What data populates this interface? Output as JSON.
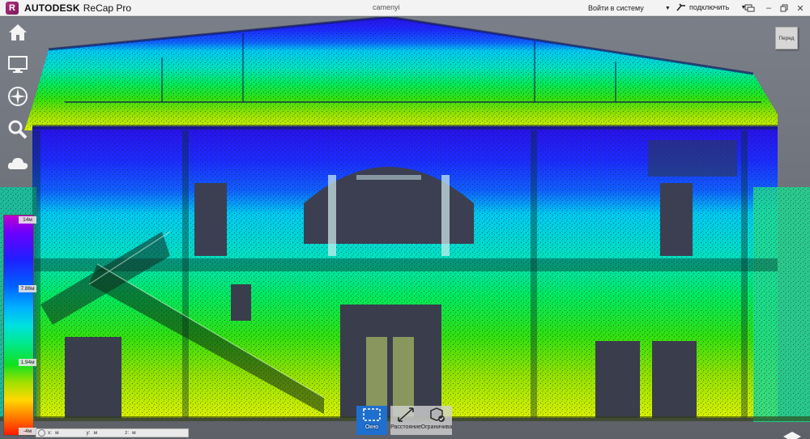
{
  "titlebar": {
    "logo_letter": "R",
    "brand": "AUTODESK",
    "product": "ReCap Pro",
    "project_name": "camenyi",
    "signin_label": "Войти в систему",
    "connect_label": "подключить"
  },
  "nav": {
    "items": [
      "home-icon",
      "monitor-icon",
      "compass-icon",
      "search-icon",
      "cloud-icon"
    ]
  },
  "legend": {
    "max": "14м",
    "upper": "7.86м",
    "lower": "1.94м",
    "min": "-4м"
  },
  "coords": {
    "x_label": "x:",
    "x_value": "м",
    "y_label": "y:",
    "y_value": "м",
    "z_label": "z:",
    "z_value": "м"
  },
  "tools": {
    "window": "Окно",
    "distance": "Расстояние",
    "limit": "Ограничива"
  },
  "viewcube": {
    "label": "Перед"
  }
}
